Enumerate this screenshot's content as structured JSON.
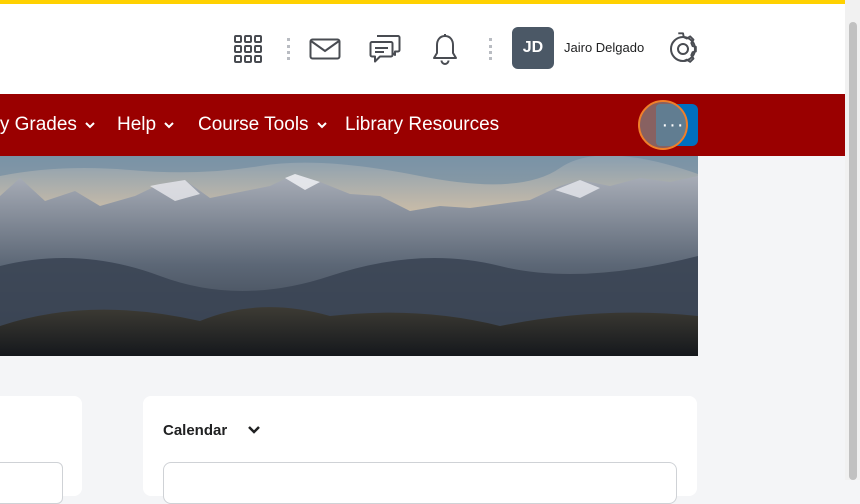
{
  "header": {
    "user": {
      "initials": "JD",
      "name": "Jairo Delgado"
    },
    "icons": [
      "apps-grid-icon",
      "mail-icon",
      "chat-icon",
      "bell-icon",
      "gear-icon"
    ]
  },
  "nav": {
    "items": [
      {
        "label": "My Grades",
        "has_dropdown": true
      },
      {
        "label": "Help",
        "has_dropdown": true
      },
      {
        "label": "Course Tools",
        "has_dropdown": true
      },
      {
        "label": "Library Resources",
        "has_dropdown": false
      }
    ],
    "more_label": "···"
  },
  "widgets": {
    "calendar": {
      "title": "Calendar"
    }
  },
  "colors": {
    "accent_top": "#ffd100",
    "navbar": "#9a0000",
    "more_button": "#006fbf",
    "focus_ring": "#f07f2a"
  }
}
